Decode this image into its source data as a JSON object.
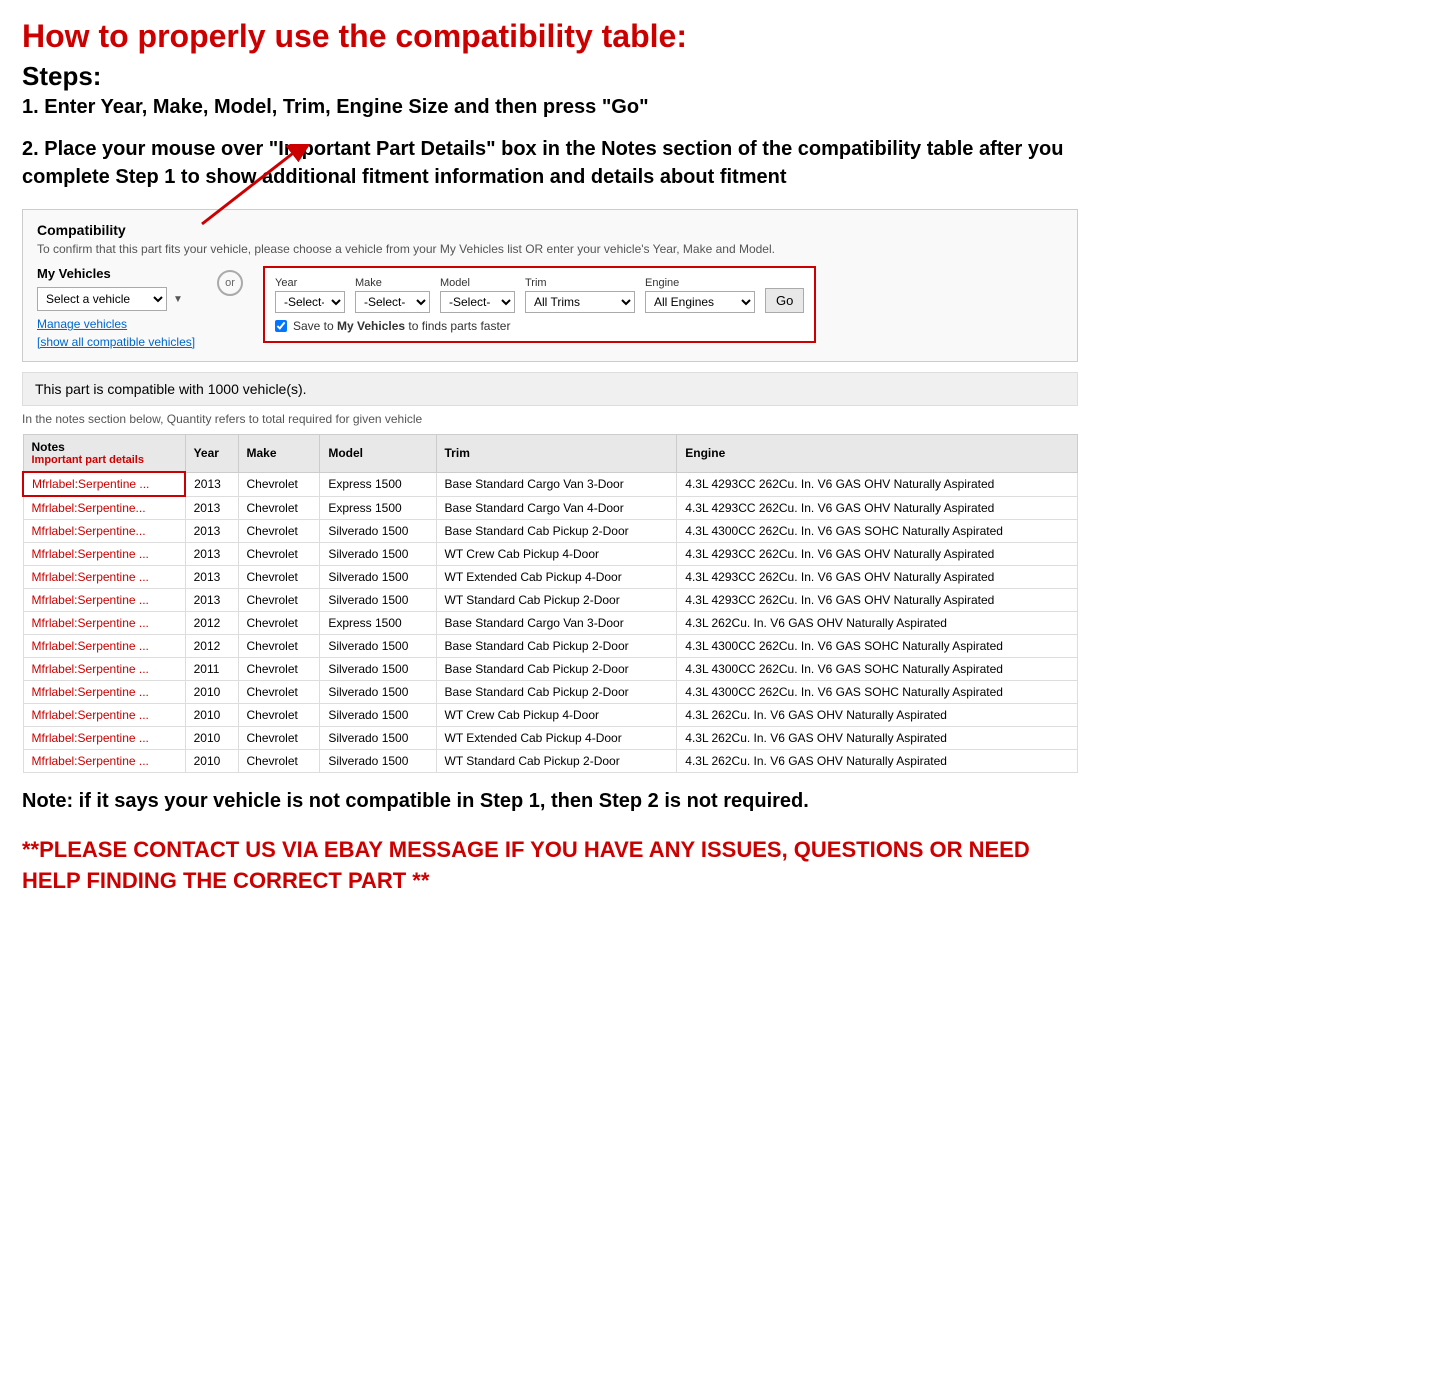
{
  "page": {
    "main_title": "How to properly use the compatibility table:",
    "steps_label": "Steps:",
    "step1": "1. Enter Year, Make, Model, Trim, Engine Size and then press \"Go\"",
    "step2": "2. Place your mouse over \"Important Part Details\" box in the Notes section of the compatibility table after you complete Step 1 to show additional fitment information and details about fitment",
    "note": "Note: if it says your vehicle is not compatible in Step 1, then Step 2 is not required.",
    "contact": "**PLEASE CONTACT US VIA EBAY MESSAGE IF YOU HAVE ANY ISSUES, QUESTIONS OR NEED HELP FINDING THE CORRECT PART **"
  },
  "compatibility": {
    "section_title": "Compatibility",
    "subtitle": "To confirm that this part fits your vehicle, please choose a vehicle from your My Vehicles list OR enter your vehicle's Year, Make and Model.",
    "my_vehicles_label": "My Vehicles",
    "select_vehicle_placeholder": "Select a vehicle",
    "manage_vehicles": "Manage vehicles",
    "show_compatible": "[show all compatible vehicles]",
    "or_label": "or",
    "year_label": "Year",
    "year_value": "-Select-",
    "make_label": "Make",
    "make_value": "-Select-",
    "model_label": "Model",
    "model_value": "-Select-",
    "trim_label": "Trim",
    "trim_value": "All Trims",
    "engine_label": "Engine",
    "engine_value": "All Engines",
    "go_label": "Go",
    "save_label": "Save to My Vehicles to finds parts faster",
    "compatible_count": "This part is compatible with 1000 vehicle(s).",
    "quantity_note": "In the notes section below, Quantity refers to total required for given vehicle",
    "table_headers": [
      "Notes",
      "Year",
      "Make",
      "Model",
      "Trim",
      "Engine"
    ],
    "notes_sub": "Important part details",
    "rows": [
      {
        "notes": "Mfrlabel:Serpentine ...",
        "year": "2013",
        "make": "Chevrolet",
        "model": "Express 1500",
        "trim": "Base Standard Cargo Van 3-Door",
        "engine": "4.3L 4293CC 262Cu. In. V6 GAS OHV Naturally Aspirated",
        "highlight": true
      },
      {
        "notes": "Mfrlabel:Serpentine...",
        "year": "2013",
        "make": "Chevrolet",
        "model": "Express 1500",
        "trim": "Base Standard Cargo Van 4-Door",
        "engine": "4.3L 4293CC 262Cu. In. V6 GAS OHV Naturally Aspirated",
        "highlight": false
      },
      {
        "notes": "Mfrlabel:Serpentine...",
        "year": "2013",
        "make": "Chevrolet",
        "model": "Silverado 1500",
        "trim": "Base Standard Cab Pickup 2-Door",
        "engine": "4.3L 4300CC 262Cu. In. V6 GAS SOHC Naturally Aspirated",
        "highlight": false
      },
      {
        "notes": "Mfrlabel:Serpentine ...",
        "year": "2013",
        "make": "Chevrolet",
        "model": "Silverado 1500",
        "trim": "WT Crew Cab Pickup 4-Door",
        "engine": "4.3L 4293CC 262Cu. In. V6 GAS OHV Naturally Aspirated",
        "highlight": false
      },
      {
        "notes": "Mfrlabel:Serpentine ...",
        "year": "2013",
        "make": "Chevrolet",
        "model": "Silverado 1500",
        "trim": "WT Extended Cab Pickup 4-Door",
        "engine": "4.3L 4293CC 262Cu. In. V6 GAS OHV Naturally Aspirated",
        "highlight": false
      },
      {
        "notes": "Mfrlabel:Serpentine ...",
        "year": "2013",
        "make": "Chevrolet",
        "model": "Silverado 1500",
        "trim": "WT Standard Cab Pickup 2-Door",
        "engine": "4.3L 4293CC 262Cu. In. V6 GAS OHV Naturally Aspirated",
        "highlight": false
      },
      {
        "notes": "Mfrlabel:Serpentine ...",
        "year": "2012",
        "make": "Chevrolet",
        "model": "Express 1500",
        "trim": "Base Standard Cargo Van 3-Door",
        "engine": "4.3L 262Cu. In. V6 GAS OHV Naturally Aspirated",
        "highlight": false
      },
      {
        "notes": "Mfrlabel:Serpentine ...",
        "year": "2012",
        "make": "Chevrolet",
        "model": "Silverado 1500",
        "trim": "Base Standard Cab Pickup 2-Door",
        "engine": "4.3L 4300CC 262Cu. In. V6 GAS SOHC Naturally Aspirated",
        "highlight": false
      },
      {
        "notes": "Mfrlabel:Serpentine ...",
        "year": "2011",
        "make": "Chevrolet",
        "model": "Silverado 1500",
        "trim": "Base Standard Cab Pickup 2-Door",
        "engine": "4.3L 4300CC 262Cu. In. V6 GAS SOHC Naturally Aspirated",
        "highlight": false
      },
      {
        "notes": "Mfrlabel:Serpentine ...",
        "year": "2010",
        "make": "Chevrolet",
        "model": "Silverado 1500",
        "trim": "Base Standard Cab Pickup 2-Door",
        "engine": "4.3L 4300CC 262Cu. In. V6 GAS SOHC Naturally Aspirated",
        "highlight": false
      },
      {
        "notes": "Mfrlabel:Serpentine ...",
        "year": "2010",
        "make": "Chevrolet",
        "model": "Silverado 1500",
        "trim": "WT Crew Cab Pickup 4-Door",
        "engine": "4.3L 262Cu. In. V6 GAS OHV Naturally Aspirated",
        "highlight": false
      },
      {
        "notes": "Mfrlabel:Serpentine ...",
        "year": "2010",
        "make": "Chevrolet",
        "model": "Silverado 1500",
        "trim": "WT Extended Cab Pickup 4-Door",
        "engine": "4.3L 262Cu. In. V6 GAS OHV Naturally Aspirated",
        "highlight": false
      },
      {
        "notes": "Mfrlabel:Serpentine ...",
        "year": "2010",
        "make": "Chevrolet",
        "model": "Silverado 1500",
        "trim": "WT Standard Cab Pickup 2-Door",
        "engine": "4.3L 262Cu. In. V6 GAS OHV Naturally Aspirated",
        "highlight": false
      }
    ]
  }
}
